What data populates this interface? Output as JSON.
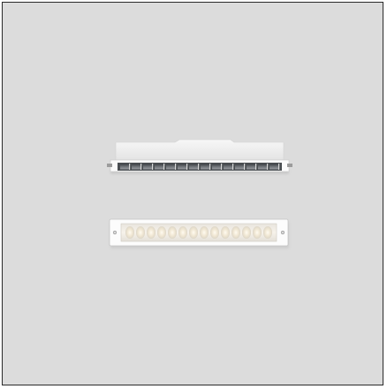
{
  "image": {
    "background_color": "#dcdcdc",
    "border_color": "#2a2a2a",
    "subjects": [
      "recessed-linear-spotlight-side-view",
      "recessed-linear-light-front-view"
    ],
    "fixture_1": {
      "housing_color": "#ffffff",
      "cell_color": "#6f7378",
      "cell_count": 14
    },
    "fixture_2": {
      "housing_color": "#ffffff",
      "lens_color": "#f3ede2",
      "led_count": 14,
      "screw_count": 2
    }
  }
}
